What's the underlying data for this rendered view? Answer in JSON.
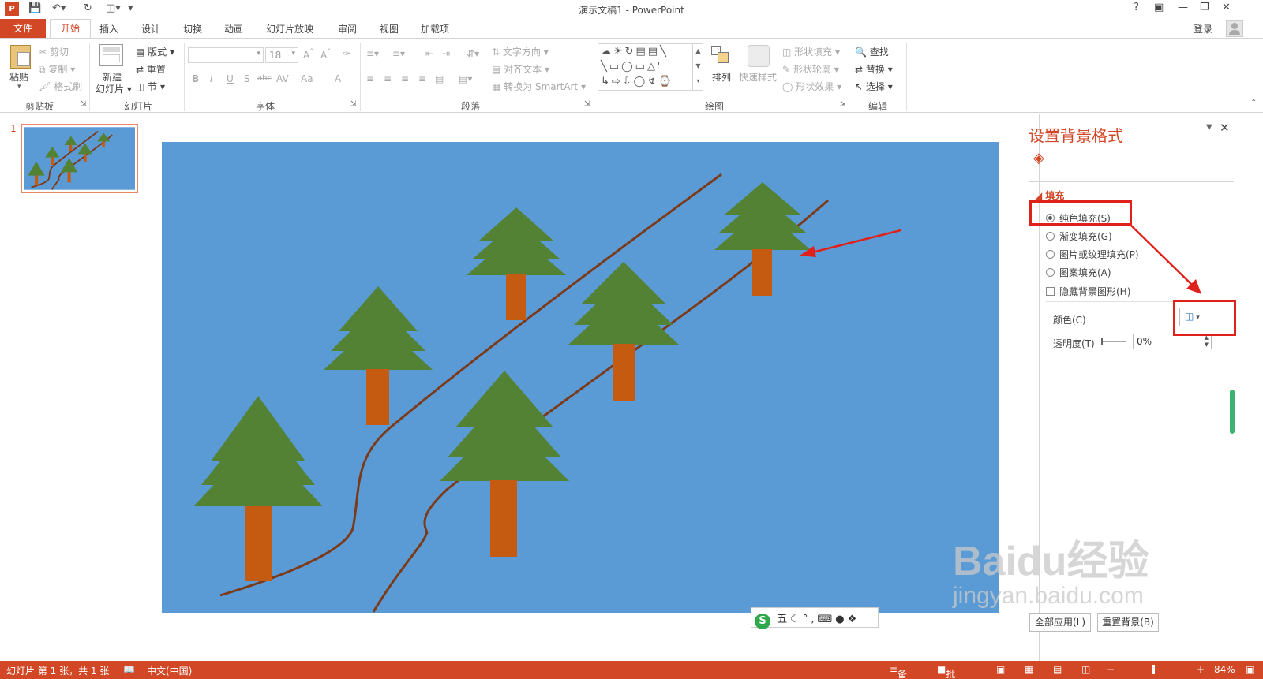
{
  "window": {
    "title": "演示文稿1 - PowerPoint",
    "help": "?",
    "login": "登录"
  },
  "tabs": {
    "file": "文件",
    "home": "开始",
    "insert": "插入",
    "design": "设计",
    "transitions": "切换",
    "animations": "动画",
    "slideshow": "幻灯片放映",
    "review": "审阅",
    "view": "视图",
    "addins": "加载项"
  },
  "ribbon": {
    "clipboard": {
      "paste": "粘贴",
      "cut": "剪切",
      "copy": "复制",
      "format_painter": "格式刷",
      "label": "剪贴板"
    },
    "slides": {
      "new_slide_1": "新建",
      "new_slide_2": "幻灯片",
      "layout": "版式",
      "reset": "重置",
      "section": "节",
      "label": "幻灯片"
    },
    "font": {
      "size": "18",
      "label": "字体",
      "bold": "B",
      "italic": "I",
      "underline": "U",
      "shadow": "S",
      "strike": "abc",
      "spacing": "AV",
      "case": "Aa",
      "color": "A"
    },
    "paragraph": {
      "text_direction": "文字方向",
      "align_text": "对齐文本",
      "smartart": "转换为 SmartArt",
      "label": "段落"
    },
    "drawing": {
      "arrange": "排列",
      "quick_styles": "快速样式",
      "shape_fill": "形状填充",
      "shape_outline": "形状轮廓",
      "shape_effects": "形状效果",
      "label": "绘图"
    },
    "editing": {
      "find": "查找",
      "replace": "替换",
      "select": "选择",
      "label": "编辑"
    }
  },
  "thumbnails": {
    "slide_number": "1"
  },
  "format_pane": {
    "title": "设置背景格式",
    "fill_section": "填充",
    "solid_fill": "纯色填充(S)",
    "gradient_fill": "渐变填充(G)",
    "picture_fill": "图片或纹理填充(P)",
    "pattern_fill": "图案填充(A)",
    "hide_bg": "隐藏背景图形(H)",
    "color_label": "颜色(C)",
    "transparency_label": "透明度(T)",
    "transparency_value": "0%",
    "apply_all": "全部应用(L)",
    "reset_bg": "重置背景(B)"
  },
  "ime": {
    "text": "五"
  },
  "watermark": {
    "brand": "Baidu经验",
    "url": "jingyan.baidu.com"
  },
  "status": {
    "slide_info": "幻灯片 第 1 张，共 1 张",
    "language": "中文(中国)",
    "notes": "备注",
    "comments": "批注",
    "zoom": "84%"
  },
  "colors": {
    "accent": "#d24726",
    "slide_bg": "#5b9bd5",
    "tree_green": "#548235",
    "trunk": "#c55a11",
    "path": "#7b3b1a",
    "annotation": "#e0201b"
  }
}
